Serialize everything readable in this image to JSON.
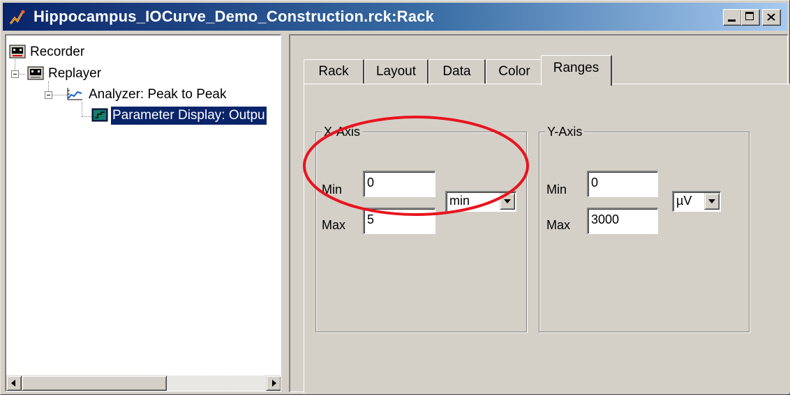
{
  "window": {
    "title": "Hippocampus_IOCurve_Demo_Construction.rck:Rack",
    "controls": [
      "minimize",
      "maximize",
      "close"
    ]
  },
  "tree": {
    "items": [
      {
        "label": "Recorder",
        "icon": "recorder-icon",
        "level": 0
      },
      {
        "label": "Replayer",
        "icon": "replayer-icon",
        "level": 0,
        "expanded": true
      },
      {
        "label": "Analyzer: Peak to Peak",
        "icon": "analyzer-icon",
        "level": 1,
        "expanded": true
      },
      {
        "label": "Parameter Display: Outpu",
        "icon": "parameter-display-icon",
        "level": 2,
        "selected": true
      }
    ]
  },
  "tabs": [
    {
      "label": "Rack"
    },
    {
      "label": "Layout"
    },
    {
      "label": "Data"
    },
    {
      "label": "Color"
    },
    {
      "label": "Ranges",
      "active": true
    }
  ],
  "ranges": {
    "x_axis": {
      "title": "X-Axis",
      "min_label": "Min",
      "min_value": "0",
      "max_label": "Max",
      "max_value": "5",
      "unit": "min"
    },
    "y_axis": {
      "title": "Y-Axis",
      "min_label": "Min",
      "min_value": "0",
      "max_label": "Max",
      "max_value": "3000",
      "unit": "µV"
    }
  },
  "colors": {
    "title_gradient_start": "#0a246a",
    "title_gradient_end": "#a6caf0",
    "face": "#d4d0c8",
    "selection": "#0a246a",
    "annotation_ellipse": "#e8141e"
  }
}
